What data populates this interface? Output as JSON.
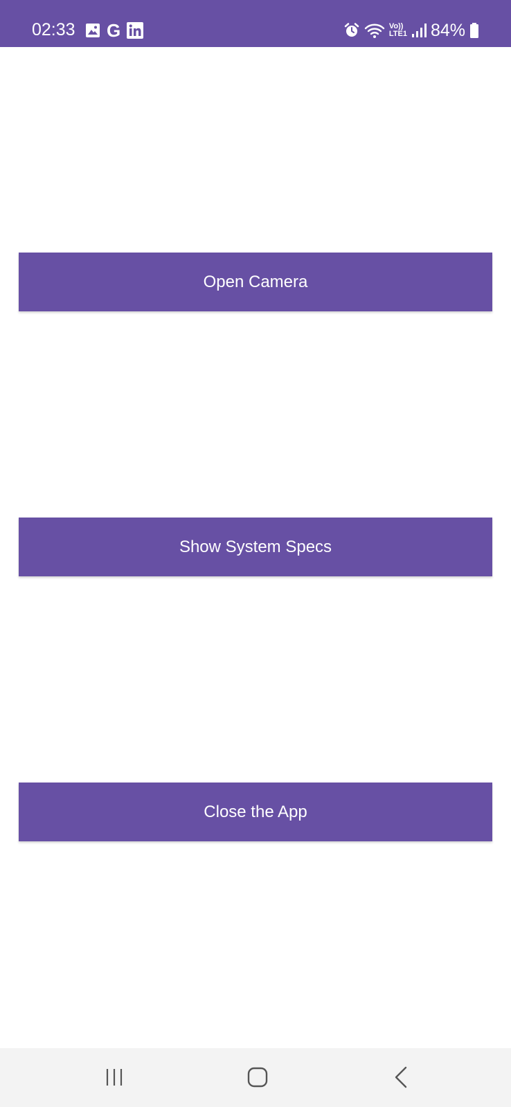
{
  "status_bar": {
    "time": "02:33",
    "battery_percent": "84%",
    "network_label_top": "Vo))",
    "network_label_bottom": "LTE1",
    "notification_icons": [
      "gallery-icon",
      "google-icon",
      "linkedin-icon"
    ],
    "system_icons": [
      "alarm-icon",
      "wifi-icon",
      "signal-icon",
      "battery-icon"
    ],
    "google_glyph": "G"
  },
  "main": {
    "open_camera_label": "Open Camera",
    "show_specs_label": "Show System Specs",
    "close_app_label": "Close the App"
  },
  "nav_bar": {
    "items": [
      "recents-icon",
      "home-icon",
      "back-icon"
    ]
  },
  "colors": {
    "primary": "#6750a4",
    "background": "#ffffff",
    "nav_background": "#f3f3f3"
  }
}
